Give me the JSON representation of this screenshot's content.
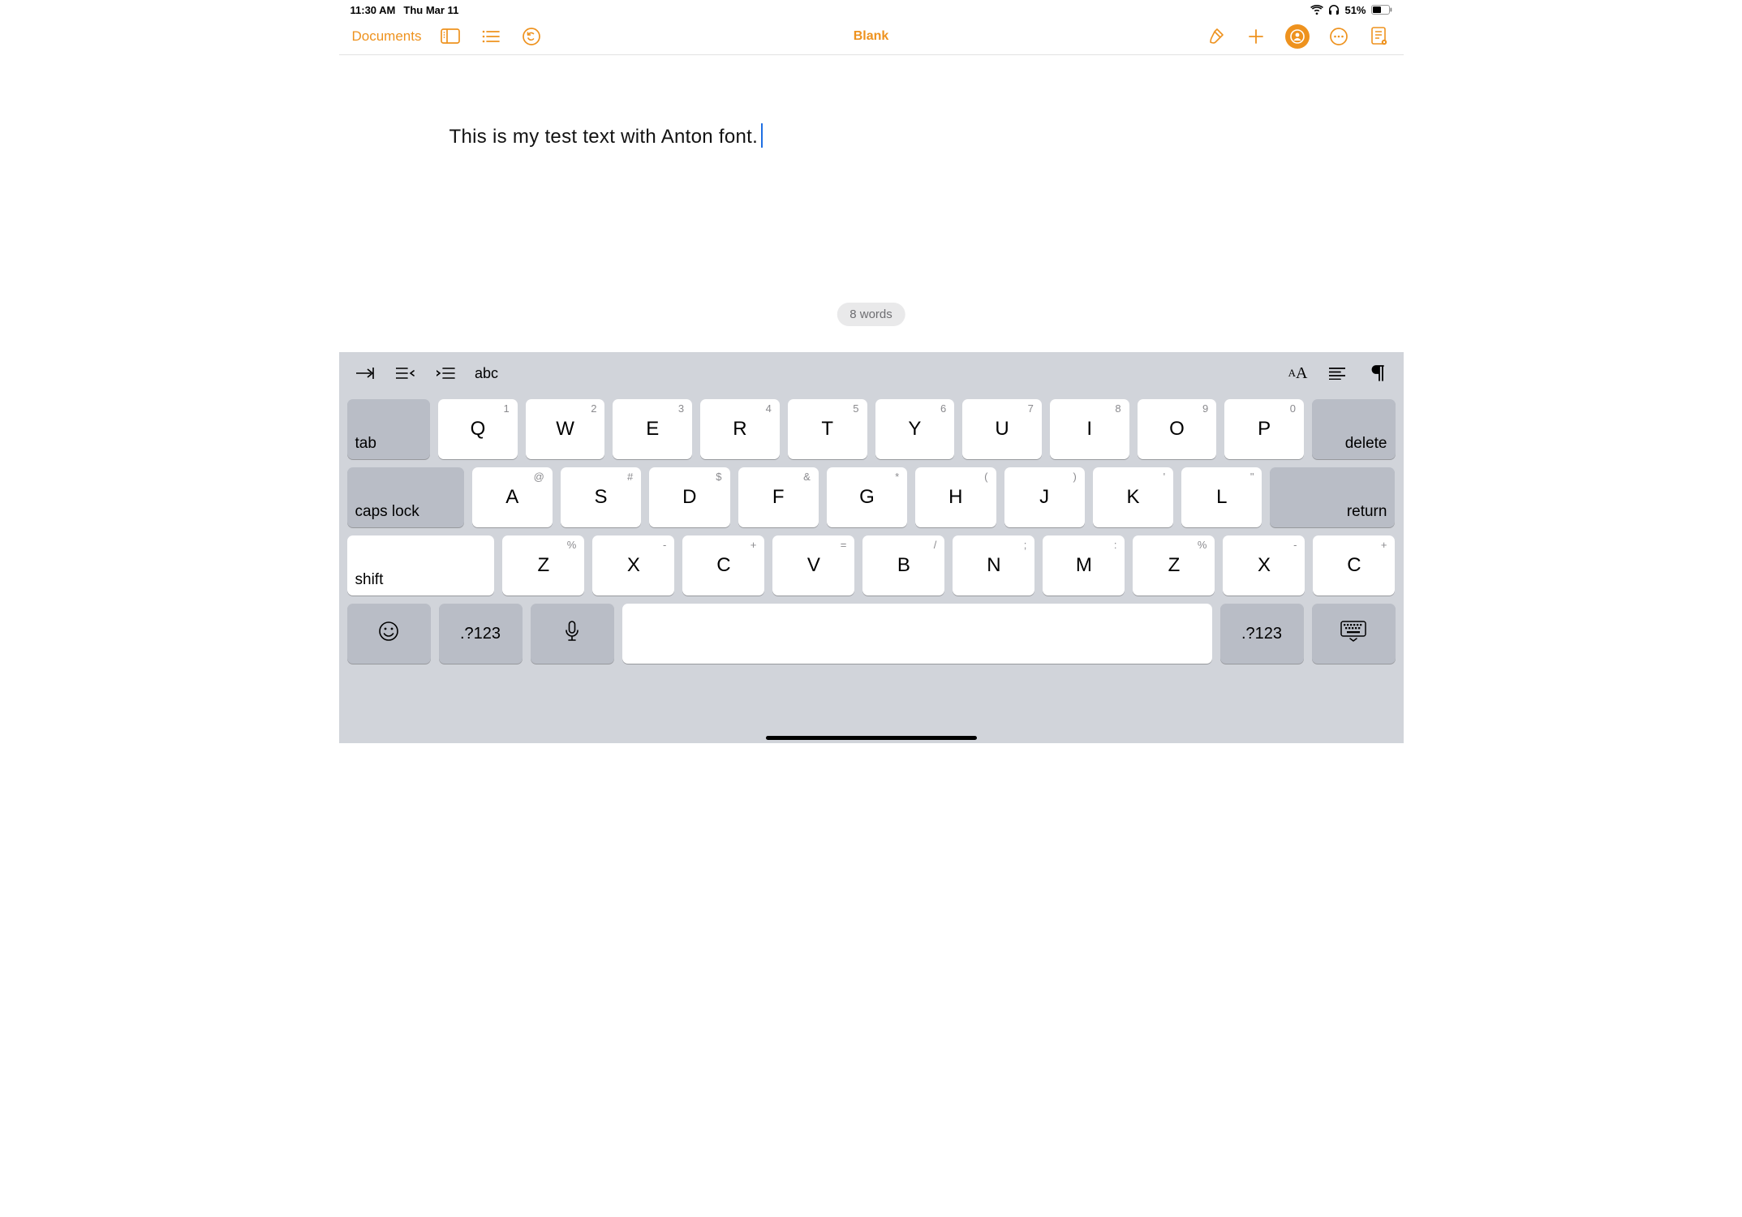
{
  "status": {
    "time": "11:30 AM",
    "date": "Thu Mar 11",
    "battery": "51%"
  },
  "toolbar": {
    "back": "Documents",
    "title": "Blank"
  },
  "document": {
    "text": "This is my test text with Anton font.",
    "word_count": "8 words"
  },
  "shortcut": {
    "abc": "abc"
  },
  "keys": {
    "row1": [
      {
        "main": "Q",
        "alt": "1"
      },
      {
        "main": "W",
        "alt": "2"
      },
      {
        "main": "E",
        "alt": "3"
      },
      {
        "main": "R",
        "alt": "4"
      },
      {
        "main": "T",
        "alt": "5"
      },
      {
        "main": "Y",
        "alt": "6"
      },
      {
        "main": "U",
        "alt": "7"
      },
      {
        "main": "I",
        "alt": "8"
      },
      {
        "main": "O",
        "alt": "9"
      },
      {
        "main": "P",
        "alt": "0"
      }
    ],
    "row2": [
      {
        "main": "A",
        "alt": "@"
      },
      {
        "main": "S",
        "alt": "#"
      },
      {
        "main": "D",
        "alt": "$"
      },
      {
        "main": "F",
        "alt": "&"
      },
      {
        "main": "G",
        "alt": "*"
      },
      {
        "main": "H",
        "alt": "("
      },
      {
        "main": "J",
        "alt": ")"
      },
      {
        "main": "K",
        "alt": "'"
      },
      {
        "main": "L",
        "alt": "\""
      }
    ],
    "row3": [
      {
        "main": "Z",
        "alt": "%"
      },
      {
        "main": "X",
        "alt": "-"
      },
      {
        "main": "C",
        "alt": "+"
      },
      {
        "main": "V",
        "alt": "="
      },
      {
        "main": "B",
        "alt": "/"
      },
      {
        "main": "N",
        "alt": ";"
      },
      {
        "main": "M",
        "alt": ":"
      }
    ],
    "punct": {
      "excl_top": "!",
      "excl_bot": ",",
      "ques_top": "?",
      "ques_bot": "."
    },
    "tab": "tab",
    "delete": "delete",
    "caps": "caps lock",
    "return": "return",
    "shift": "shift",
    "symbols": ".?123"
  }
}
